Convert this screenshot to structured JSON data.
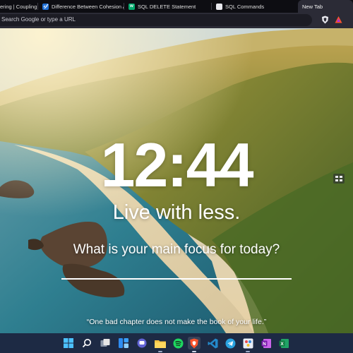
{
  "browser": {
    "tabs": [
      {
        "label": "ering | Coupling",
        "favicon": "none",
        "active": false
      },
      {
        "label": "Difference Between Cohesion And",
        "favicon": "link-icon",
        "active": false
      },
      {
        "label": "SQL DELETE Statement",
        "favicon": "w3schools-icon",
        "active": false
      },
      {
        "label": "SQL Commands",
        "favicon": "document-icon",
        "active": false
      },
      {
        "label": "New Tab",
        "favicon": "none",
        "active": true
      }
    ],
    "address_placeholder": "Search Google or type a URL",
    "toolbar_icons": [
      "brave-shield-icon",
      "brave-rewards-icon"
    ]
  },
  "newtab": {
    "clock": "12:44",
    "mantra": "Live with less.",
    "focus_question": "What is your main focus for today?",
    "focus_value": "",
    "quote": "“One bad chapter does not make the book of your life.”"
  },
  "taskbar": {
    "items": [
      "windows-start-icon",
      "search-icon",
      "task-view-icon",
      "widgets-icon",
      "chat-icon",
      "file-explorer-icon",
      "spotify-icon",
      "brave-browser-icon",
      "vscode-icon",
      "telegram-icon",
      "paint-icon",
      "onenote-icon",
      "excel-icon"
    ]
  },
  "colors": {
    "tab_strip": "#0d0d12",
    "toolbar": "#2b2b36",
    "taskbar": "#1d2a44",
    "brave_orange": "#fb542b",
    "text_white": "#ffffff"
  }
}
